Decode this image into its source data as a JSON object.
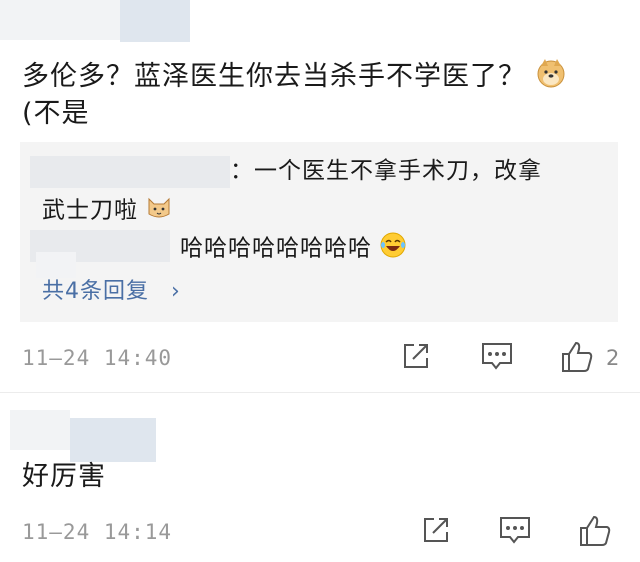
{
  "comments": [
    {
      "text": "多伦多？蓝泽医生你去当杀手不学医了？",
      "text_line2": "(不是",
      "emoji": "doge-emoji",
      "reply": {
        "line1": "：一个医生不拿手术刀，改拿",
        "line2": "武士刀啦",
        "line2_emoji": "cat-emoji",
        "second_reply": "哈哈哈哈哈哈哈哈",
        "second_emoji": "laughing-tears-emoji",
        "more_label": "共4条回复",
        "more_chevron": "›"
      },
      "timestamp": "11—24 14:40",
      "like_count": "2"
    },
    {
      "text": "好厉害",
      "timestamp": "11—24 14:14",
      "like_count": ""
    }
  ],
  "icons": [
    "share-icon",
    "comment-icon",
    "like-icon"
  ],
  "colors": {
    "link": "#4a6fa5",
    "meta": "#999999",
    "reply_bg": "#f4f4f4"
  }
}
